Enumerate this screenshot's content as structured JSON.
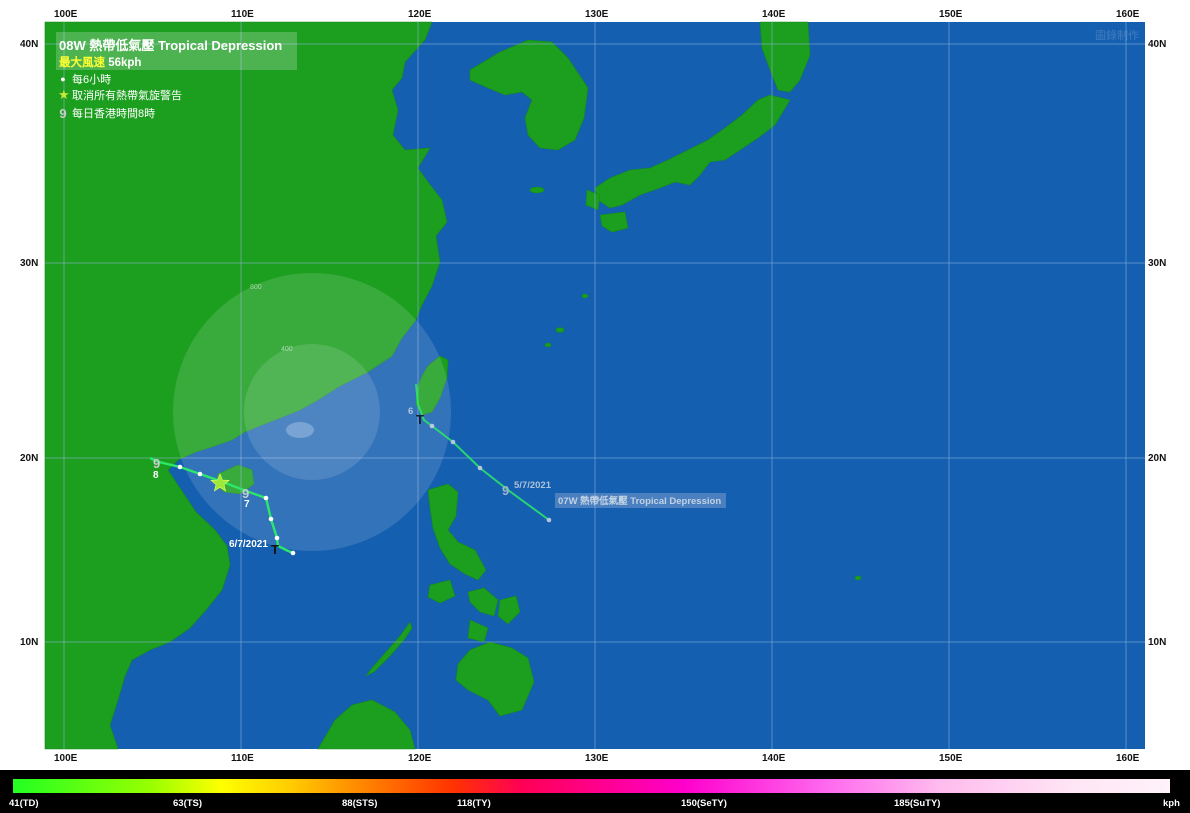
{
  "legend": {
    "title": "08W 熱帶低氣壓 Tropical Depression",
    "max_wind_label": "最大風速",
    "max_wind_value": "56kph",
    "every6h": "每6小時",
    "cancel": "取消所有熱帶氣旋警告",
    "daily8": "每日香港時間8時"
  },
  "watermark": "圖錄制作",
  "axes": {
    "lon": [
      "100E",
      "110E",
      "120E",
      "130E",
      "140E",
      "150E",
      "160E"
    ],
    "lat": [
      "40N",
      "30N",
      "20N",
      "10N"
    ]
  },
  "radii": [
    "800",
    "400"
  ],
  "track_08w": {
    "start_label": "6/7/2021",
    "day_labels": [
      "7",
      "8"
    ]
  },
  "track_07w": {
    "name": "07W 熱帶低氣壓 Tropical Depression",
    "date_label": "5/7/2021",
    "day_label": "6"
  },
  "scale": {
    "ticks": [
      "41(TD)",
      "63(TS)",
      "88(STS)",
      "118(TY)",
      "150(SeTY)",
      "185(SuTY)",
      "kph"
    ],
    "colors": {
      "td": "#22ff22",
      "ts": "#ffff00",
      "sts": "#ff8800",
      "ty": "#ff0055",
      "sety": "#ff00cc",
      "suty": "#ffe6f5"
    }
  },
  "colors": {
    "sea": "#155fb0",
    "land": "#1c9e1f",
    "track": "#2be86a",
    "grid": "#8fb3dc"
  }
}
